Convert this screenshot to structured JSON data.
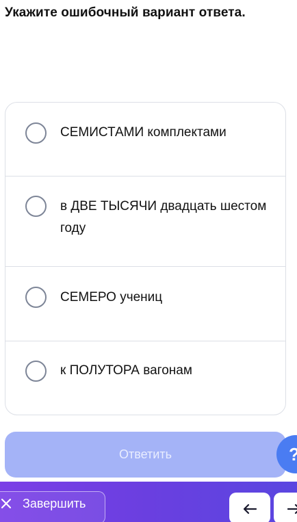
{
  "question": {
    "title": "Укажите ошибочный вариант ответа."
  },
  "options": [
    {
      "label": "СЕМИСТАМИ комплектами"
    },
    {
      "label": "в ДВЕ ТЫСЯЧИ двадцать шестом году"
    },
    {
      "label": "СЕМЕРО учениц"
    },
    {
      "label": "к ПОЛУТОРА вагонам"
    }
  ],
  "actions": {
    "submit_label": "Ответить",
    "help_label": "?"
  },
  "bottom_bar": {
    "finish_label": "Завершить"
  },
  "colors": {
    "submit_bg": "#a4b3f7",
    "help_bg": "#4a7cf2",
    "bar_gradient_start": "#7b3fe6",
    "bar_gradient_end": "#5a46e0"
  },
  "icons": {
    "finish": "close-icon",
    "prev": "arrow-left-icon",
    "next": "arrow-right-icon"
  }
}
